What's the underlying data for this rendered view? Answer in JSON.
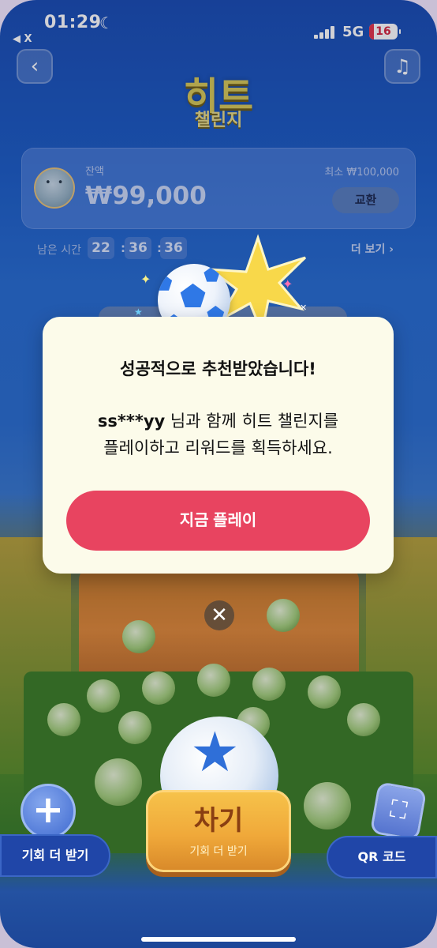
{
  "status_bar": {
    "time": "01:29",
    "network": "5G",
    "battery": "16",
    "back_app": "◀ X"
  },
  "header": {
    "logo_main": "히트",
    "logo_sub": "챌린지"
  },
  "balance": {
    "label": "잔액",
    "amount": "₩99,000",
    "min_label": "최소 ₩100,000",
    "exchange_label": "교환"
  },
  "timer": {
    "label": "남은 시간",
    "hours": "22",
    "minutes": "36",
    "seconds": "36",
    "more_label": "더 보기 ›"
  },
  "modal": {
    "title": "성공적으로 추천받았습니다!",
    "username": "ss***yy",
    "message_line1_rest": " 님과 함께 히트 챌린지를",
    "message_line2": "플레이하고 리워드를 획득하세요.",
    "play_label": "지금 플레이"
  },
  "bottom": {
    "more_chance_label": "기회 더 받기",
    "kick_label": "차기",
    "kick_sub_label": "기회 더 받기",
    "qr_label": "QR 코드"
  },
  "icons": {
    "back": "back-icon",
    "music": "music-icon",
    "close": "close-icon",
    "plus": "plus-icon",
    "qr": "qr-scan-icon"
  },
  "colors": {
    "accent": "#e84460",
    "logo_gold": "#d7c85a",
    "modal_bg": "#fcfbea",
    "pill_blue": "#2046a8"
  }
}
